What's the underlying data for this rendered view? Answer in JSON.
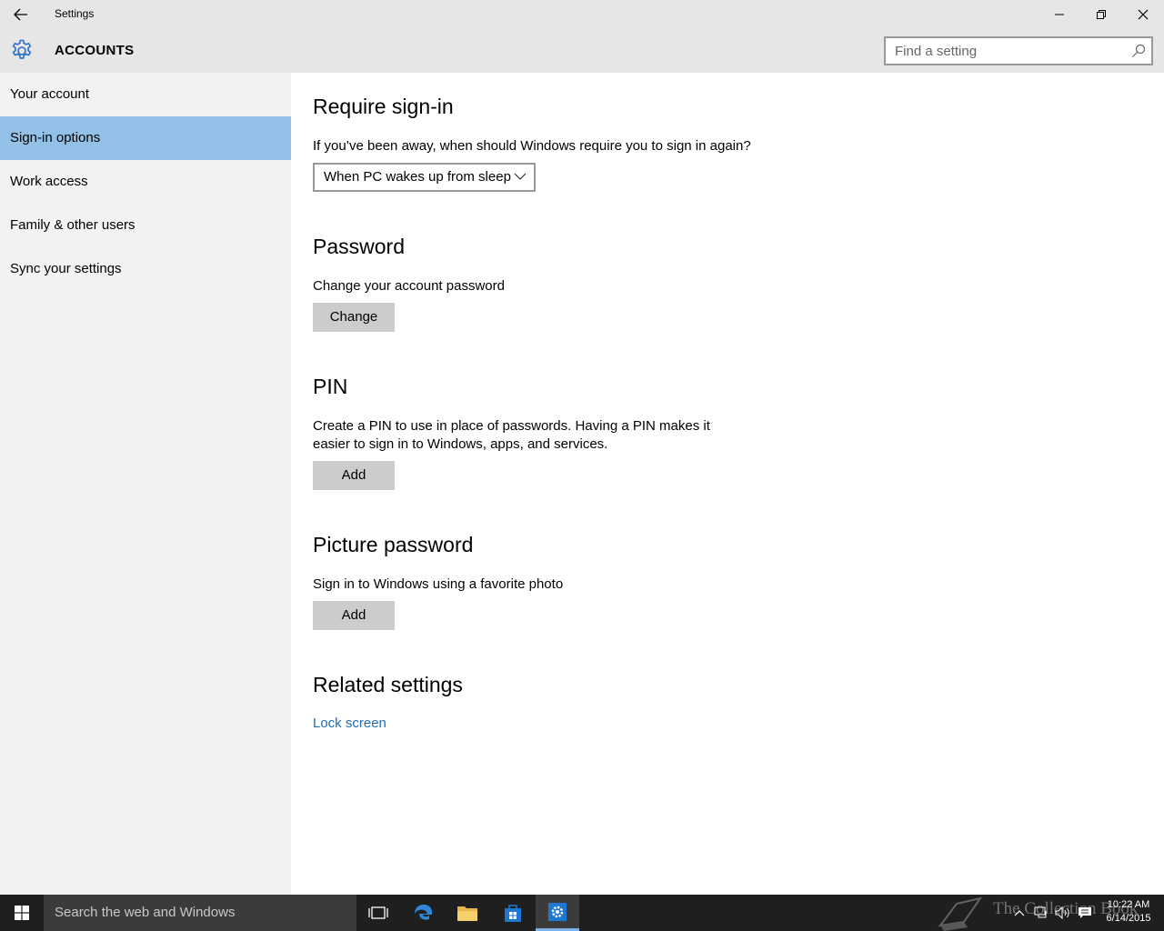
{
  "window": {
    "title": "Settings",
    "back_icon": "back-arrow-icon",
    "controls": [
      "minimize-icon",
      "restore-icon",
      "close-icon"
    ]
  },
  "header": {
    "icon": "gear-icon",
    "section": "ACCOUNTS",
    "search_placeholder": "Find a setting",
    "accent": "#2a70c8"
  },
  "sidebar": {
    "items": [
      {
        "label": "Your account",
        "active": false
      },
      {
        "label": "Sign-in options",
        "active": true
      },
      {
        "label": "Work access",
        "active": false
      },
      {
        "label": "Family & other users",
        "active": false
      },
      {
        "label": "Sync your settings",
        "active": false
      }
    ],
    "active_color": "#92c0e6"
  },
  "main": {
    "require_signin": {
      "heading": "Require sign-in",
      "question": "If you’ve been away, when should Windows require you to sign in again?",
      "dropdown_value": "When PC wakes up from sleep"
    },
    "password": {
      "heading": "Password",
      "description": "Change your account password",
      "button": "Change"
    },
    "pin": {
      "heading": "PIN",
      "description_line1": "Create a PIN to use in place of passwords. Having a PIN makes it",
      "description_line2": "easier to sign in to Windows, apps, and services.",
      "button": "Add"
    },
    "picture_password": {
      "heading": "Picture password",
      "description": "Sign in to Windows using a favorite photo",
      "button": "Add"
    },
    "related": {
      "heading": "Related settings",
      "link": "Lock screen",
      "link_color": "#1e6eb4"
    }
  },
  "taskbar": {
    "search_placeholder": "Search the web and Windows",
    "pinned": [
      "task-view-icon",
      "edge-icon",
      "file-explorer-icon",
      "store-icon",
      "settings-icon"
    ],
    "active_app": "settings-icon",
    "tray": [
      "chevron-up-icon",
      "network-icon",
      "volume-icon",
      "action-center-icon"
    ],
    "time": "10:22 AM",
    "date": "6/14/2015",
    "watermark": "The Collection Book"
  }
}
